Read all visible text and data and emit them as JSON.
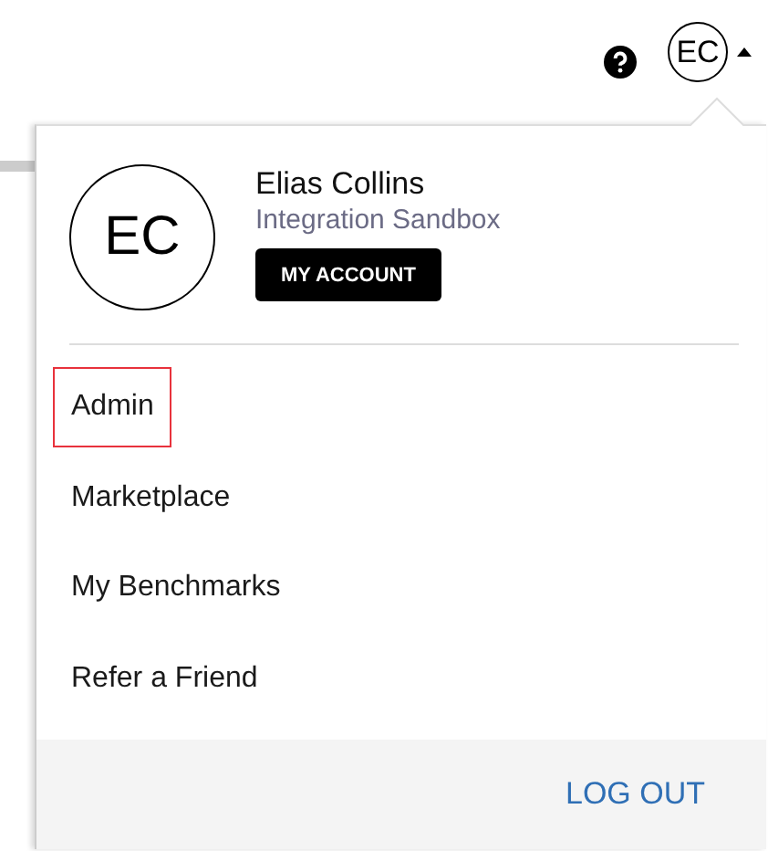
{
  "header": {
    "avatar_initials": "EC"
  },
  "profile": {
    "avatar_initials": "EC",
    "name": "Elias Collins",
    "organization": "Integration Sandbox",
    "account_button": "MY ACCOUNT"
  },
  "menu": [
    {
      "label": "Admin",
      "selected": true
    },
    {
      "label": "Marketplace",
      "selected": false
    },
    {
      "label": "My Benchmarks",
      "selected": false
    },
    {
      "label": "Refer a Friend",
      "selected": false
    }
  ],
  "footer": {
    "logout_button": "LOG OUT"
  }
}
